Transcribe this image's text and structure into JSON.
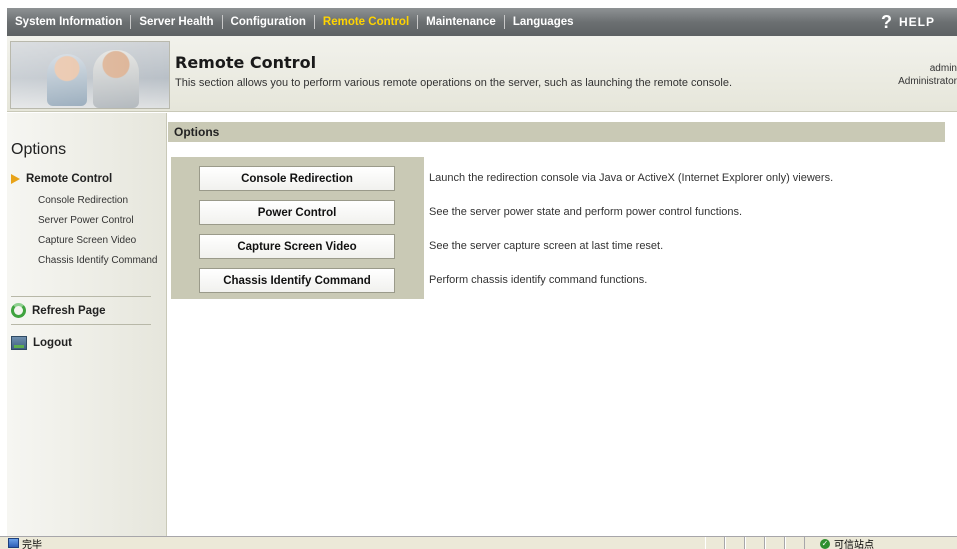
{
  "nav": {
    "items": [
      {
        "label": "System Information",
        "active": false
      },
      {
        "label": "Server Health",
        "active": false
      },
      {
        "label": "Configuration",
        "active": false
      },
      {
        "label": "Remote Control",
        "active": true
      },
      {
        "label": "Maintenance",
        "active": false
      },
      {
        "label": "Languages",
        "active": false
      }
    ],
    "help_label": "HELP",
    "help_glyph": "?"
  },
  "header": {
    "title": "Remote Control",
    "description": "This section allows you to perform various remote operations on the server, such as launching the remote console.",
    "user_name": "admin",
    "user_role": "Administrator"
  },
  "sidebar": {
    "title": "Options",
    "section_label": "Remote Control",
    "items": [
      {
        "label": "Console Redirection"
      },
      {
        "label": "Server Power Control"
      },
      {
        "label": "Capture Screen Video"
      },
      {
        "label": "Chassis Identify Command"
      }
    ],
    "refresh_label": "Refresh Page",
    "logout_label": "Logout"
  },
  "main": {
    "bar_title": "Options",
    "actions": [
      {
        "label": "Console Redirection",
        "description": "Launch the redirection console via Java or ActiveX (Internet Explorer only) viewers."
      },
      {
        "label": "Power Control",
        "description": "See the server power state and perform power control functions."
      },
      {
        "label": "Capture Screen Video",
        "description": "See the server capture screen at last time reset."
      },
      {
        "label": "Chassis Identify Command",
        "description": "Perform chassis identify command functions."
      }
    ]
  },
  "statusbar": {
    "left_text": "完毕",
    "zone_text": "可信站点"
  },
  "colors": {
    "nav_bg": "#6c7072",
    "nav_active": "#ffd400",
    "accent_olive": "#c9c9b5",
    "arrow": "#e8a318"
  }
}
